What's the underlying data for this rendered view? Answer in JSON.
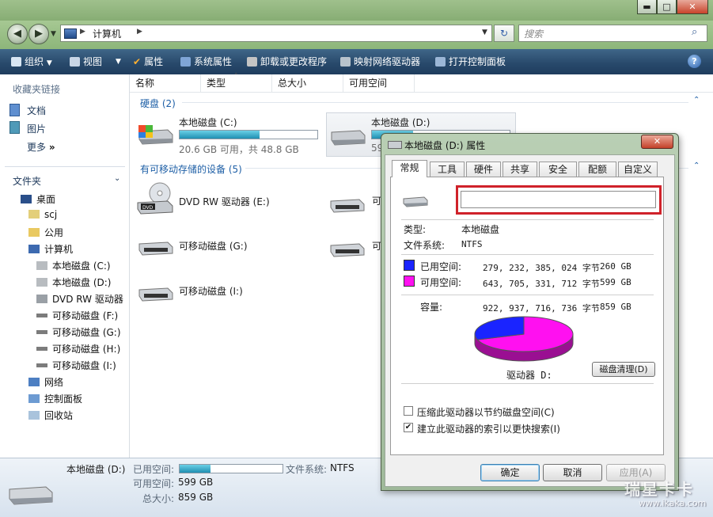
{
  "window": {
    "minimize": "▬",
    "maximize": "□",
    "close": "✕"
  },
  "address": {
    "breadcrumb": "计算机",
    "search_placeholder": "搜索"
  },
  "toolbar": {
    "organize": "组织",
    "views": "视图",
    "properties": "属性",
    "system_properties": "系统属性",
    "uninstall": "卸载或更改程序",
    "map_drive": "映射网络驱动器",
    "control_panel": "打开控制面板"
  },
  "sidebar": {
    "favorites_title": "收藏夹链接",
    "favorites": [
      "文档",
      "图片"
    ],
    "more": "更多",
    "folders_title": "文件夹",
    "tree": [
      "桌面",
      "scj",
      "公用",
      "计算机",
      "本地磁盘 (C:)",
      "本地磁盘 (D:)",
      "DVD RW 驱动器",
      "可移动磁盘 (F:)",
      "可移动磁盘 (G:)",
      "可移动磁盘 (H:)",
      "可移动磁盘 (I:)",
      "网络",
      "控制面板",
      "回收站"
    ]
  },
  "columns": [
    "名称",
    "类型",
    "总大小",
    "可用空间"
  ],
  "hard_disks": {
    "header": "硬盘 (2)",
    "c_name": "本地磁盘 (C:)",
    "c_free_text": "20.6 GB 可用，共 48.8 GB",
    "c_used_fraction": 0.58,
    "d_name": "本地磁盘 (D:)",
    "d_free_text": "59",
    "d_used_fraction": 0.3
  },
  "removable": {
    "header": "有可移动存储的设备 (5)",
    "items": [
      "DVD RW 驱动器 (E:)",
      "可移动磁盘 (G:)",
      "可移动磁盘 (I:)"
    ],
    "partial": [
      "可",
      "可"
    ]
  },
  "status": {
    "drive": "本地磁盘 (D:)",
    "used_label": "已用空间:",
    "free_label": "可用空间:",
    "free_value": "599 GB",
    "total_label": "总大小:",
    "total_value": "859 GB",
    "fs_label": "文件系统:",
    "fs_value": "NTFS",
    "used_fraction": 0.3
  },
  "dialog": {
    "title": "本地磁盘 (D:) 属性",
    "tabs": [
      "常规",
      "工具",
      "硬件",
      "共享",
      "安全",
      "配额",
      "自定义"
    ],
    "name_value": "",
    "type_label": "类型:",
    "type_value": "本地磁盘",
    "fs_label": "文件系统:",
    "fs_value": "NTFS",
    "used_label": "已用空间:",
    "used_bytes": "279, 232, 385, 024 字节",
    "used_gb": "260 GB",
    "free_label": "可用空间:",
    "free_bytes": "643, 705, 331, 712 字节",
    "free_gb": "599 GB",
    "capacity_label": "容量:",
    "capacity_bytes": "922, 937, 716, 736 字节",
    "capacity_gb": "859 GB",
    "drive_label": "驱动器 D:",
    "cleanup_button": "磁盘清理(D)",
    "compress_label": "压缩此驱动器以节约磁盘空间(C)",
    "compress_checked": false,
    "index_label": "建立此驱动器的索引以更快搜索(I)",
    "index_checked": true,
    "ok": "确定",
    "cancel": "取消",
    "apply": "应用(A)",
    "used_fraction": 0.3027,
    "used_color": "#1a24ff",
    "free_color": "#ff10f0"
  },
  "watermark": {
    "brand": "瑞星卡卡",
    "url": "www.ikaka.com"
  }
}
